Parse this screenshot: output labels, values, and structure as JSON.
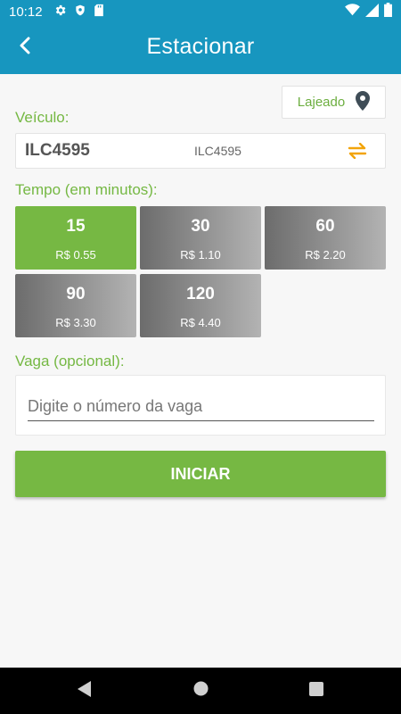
{
  "status_bar": {
    "time": "10:12"
  },
  "header": {
    "title": "Estacionar"
  },
  "location": {
    "city": "Lajeado"
  },
  "vehicle": {
    "label": "Veículo:",
    "plate": "ILC4595",
    "description": "ILC4595"
  },
  "time": {
    "label": "Tempo (em minutos):",
    "options": [
      {
        "minutes": "15",
        "price": "R$ 0.55",
        "selected": true
      },
      {
        "minutes": "30",
        "price": "R$ 1.10",
        "selected": false
      },
      {
        "minutes": "60",
        "price": "R$ 2.20",
        "selected": false
      },
      {
        "minutes": "90",
        "price": "R$ 3.30",
        "selected": false
      },
      {
        "minutes": "120",
        "price": "R$ 4.40",
        "selected": false
      }
    ]
  },
  "vaga": {
    "label": "Vaga (opcional):",
    "value": "",
    "placeholder": "Digite o número da vaga"
  },
  "actions": {
    "start_label": "INICIAR"
  },
  "colors": {
    "primary": "#1796bf",
    "accent": "#76b843",
    "swap_icon": "#f2a40a"
  },
  "icons": [
    "settings-icon",
    "shield-icon",
    "sd-card-icon",
    "wifi-icon",
    "cellular-icon",
    "battery-icon",
    "back-arrow-icon",
    "location-pin-icon",
    "swap-icon",
    "nav-back-icon",
    "nav-home-icon",
    "nav-recents-icon"
  ]
}
